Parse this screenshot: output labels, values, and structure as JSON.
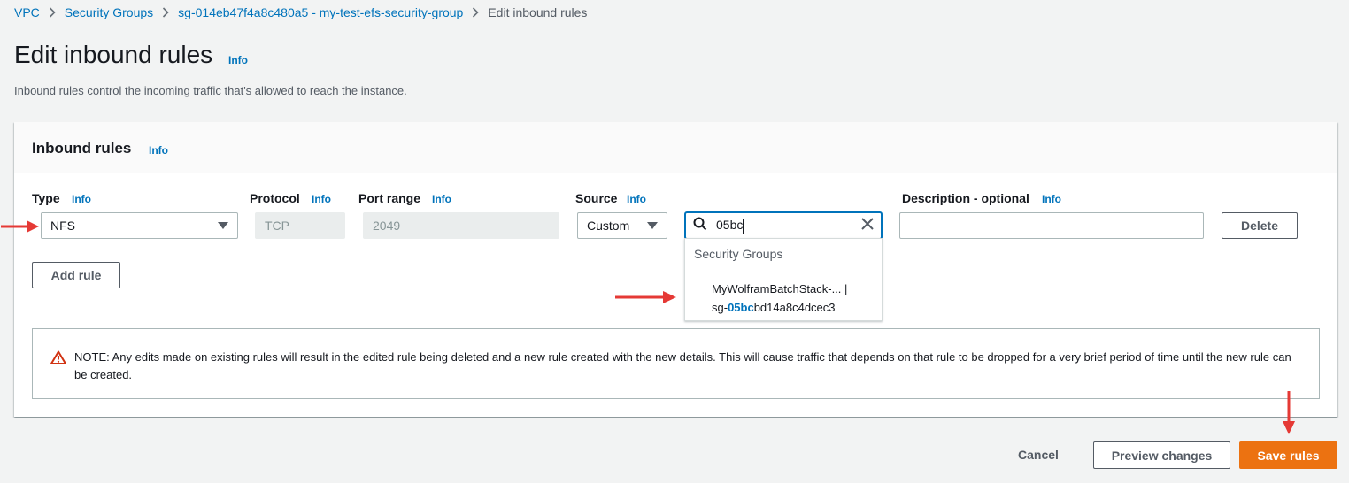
{
  "breadcrumb": {
    "items": [
      "VPC",
      "Security Groups",
      "sg-014eb47f4a8c480a5 - my-test-efs-security-group",
      "Edit inbound rules"
    ]
  },
  "page": {
    "title": "Edit inbound rules",
    "info": "Info",
    "description": "Inbound rules control the incoming traffic that's allowed to reach the instance."
  },
  "inbound_rules": {
    "title": "Inbound rules",
    "info": "Info",
    "columns": {
      "type": "Type",
      "protocol": "Protocol",
      "port_range": "Port range",
      "source": "Source",
      "description": "Description - optional",
      "info": "Info"
    },
    "rule": {
      "type": "NFS",
      "protocol": "TCP",
      "port_range": "2049",
      "source_type": "Custom",
      "source_search": "05bc",
      "description": "",
      "delete_label": "Delete"
    },
    "dropdown": {
      "group_label": "Security Groups",
      "option_name": "MyWolframBatchStack-... |",
      "option_id_prefix": "sg-",
      "option_id_match": "05bc",
      "option_id_rest": "bd14a8c4dcec3"
    },
    "add_rule_label": "Add rule",
    "note": "NOTE: Any edits made on existing rules will result in the edited rule being deleted and a new rule created with the new details. This will cause traffic that depends on that rule to be dropped for a very brief period of time until the new rule can be created."
  },
  "footer": {
    "cancel_label": "Cancel",
    "preview_label": "Preview changes",
    "save_label": "Save rules"
  },
  "colors": {
    "link": "#0073bb",
    "primary": "#ec7211",
    "annotation_arrow": "#e53935",
    "background": "#f2f3f3"
  },
  "icons": [
    "chevron-right-icon",
    "caret-down-icon",
    "search-icon",
    "close-icon",
    "warning-icon",
    "annotation-arrow-icon"
  ]
}
